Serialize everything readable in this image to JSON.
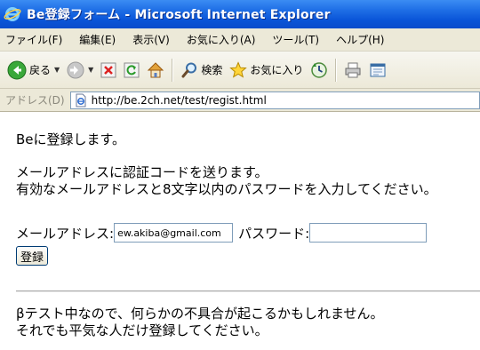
{
  "window": {
    "title": "Be登録フォーム - Microsoft Internet Explorer"
  },
  "menu": {
    "items": [
      "ファイル(F)",
      "編集(E)",
      "表示(V)",
      "お気に入り(A)",
      "ツール(T)",
      "ヘルプ(H)"
    ]
  },
  "toolbar": {
    "back_label": "戻る",
    "search_label": "検索",
    "favorites_label": "お気に入り"
  },
  "address": {
    "label": "アドレス(D)",
    "url": "http://be.2ch.net/test/regist.html"
  },
  "page": {
    "intro": "Beに登録します。",
    "send_line1": "メールアドレスに認証コードを送ります。",
    "send_line2": "有効なメールアドレスと8文字以内のパスワードを入力してください。",
    "email_label": "メールアドレス:",
    "email_value": "ew.akiba@gmail.com",
    "password_label": "パスワード:",
    "password_value": "",
    "submit_label": "登録",
    "warning_line1": "βテスト中なので、何らかの不具合が起こるかもしれません。",
    "warning_line2": "それでも平気な人だけ登録してください。"
  },
  "colors": {
    "titlebar": "#0a55d8",
    "chrome": "#ece9d8",
    "input_border": "#7f9db9"
  },
  "icons": [
    "ie-logo-icon",
    "back-arrow-icon",
    "forward-arrow-icon",
    "stop-icon",
    "refresh-icon",
    "home-icon",
    "search-icon",
    "favorites-star-icon",
    "history-icon",
    "print-icon",
    "edit-icon",
    "page-icon"
  ]
}
